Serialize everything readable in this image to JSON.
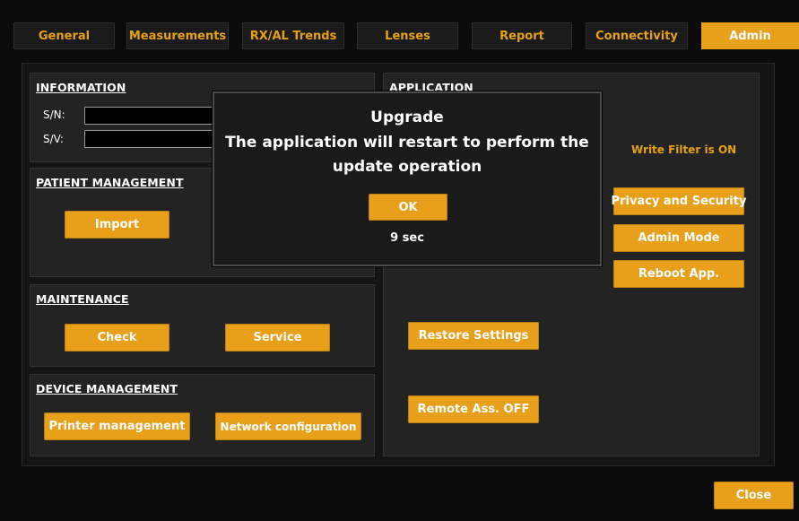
{
  "tabs": [
    {
      "label": "General",
      "active": false
    },
    {
      "label": "Measurements",
      "active": false
    },
    {
      "label": "RX/AL Trends",
      "active": false
    },
    {
      "label": "Lenses",
      "active": false
    },
    {
      "label": "Report",
      "active": false
    },
    {
      "label": "Connectivity",
      "active": false
    },
    {
      "label": "Admin",
      "active": true
    }
  ],
  "information": {
    "title": "INFORMATION",
    "sn_label": "S/N:",
    "sn_value": "",
    "sv_label": "S/V:",
    "sv_value": ""
  },
  "patient_management": {
    "title": "PATIENT MANAGEMENT",
    "import_label": "Import"
  },
  "maintenance": {
    "title": "MAINTENANCE",
    "check_label": "Check",
    "service_label": "Service"
  },
  "device_management": {
    "title": "DEVICE MANAGEMENT",
    "printer_label": "Printer management",
    "network_label": "Network configuration"
  },
  "application": {
    "title": "APPLICATION",
    "write_filter_status": "Write Filter is ON",
    "privacy_label": "Privacy and Security",
    "admin_mode_label": "Admin Mode",
    "reboot_label": "Reboot App.",
    "restore_label": "Restore Settings",
    "remote_label": "Remote Ass. OFF"
  },
  "modal": {
    "title": "Upgrade",
    "message_line1": "The application will restart to perform the",
    "message_line2": "update operation",
    "ok_label": "OK",
    "countdown": "9 sec"
  },
  "footer": {
    "close_label": "Close"
  },
  "colors": {
    "accent": "#e8a01a",
    "background": "#0b0b0b",
    "panel": "#232323"
  }
}
